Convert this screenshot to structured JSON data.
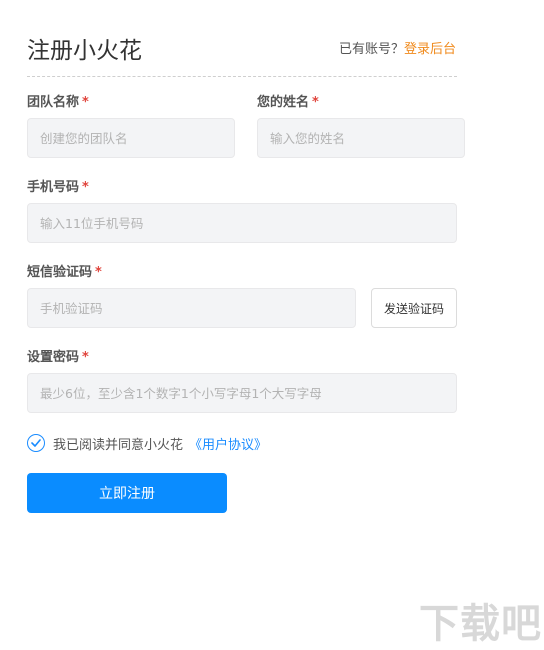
{
  "header": {
    "title": "注册小火花",
    "login_hint": "已有账号？",
    "login_link": "登录后台"
  },
  "form": {
    "required_mark": "*",
    "team_name": {
      "label": "团队名称",
      "placeholder": "创建您的团队名"
    },
    "your_name": {
      "label": "您的姓名",
      "placeholder": "输入您的姓名"
    },
    "phone": {
      "label": "手机号码",
      "placeholder": "输入11位手机号码"
    },
    "sms_code": {
      "label": "短信验证码",
      "placeholder": "手机验证码",
      "send_button": "发送验证码"
    },
    "password": {
      "label": "设置密码",
      "placeholder": "最少6位，至少含1个数字1个小写字母1个大写字母"
    },
    "agreement": {
      "text": "我已阅读并同意小火花",
      "link": "《用户协议》",
      "checked": true
    },
    "submit_label": "立即注册"
  },
  "watermark": "下载吧",
  "colors": {
    "accent": "#0a8cff",
    "link_orange": "#f08a1c",
    "required": "#e0443c"
  }
}
